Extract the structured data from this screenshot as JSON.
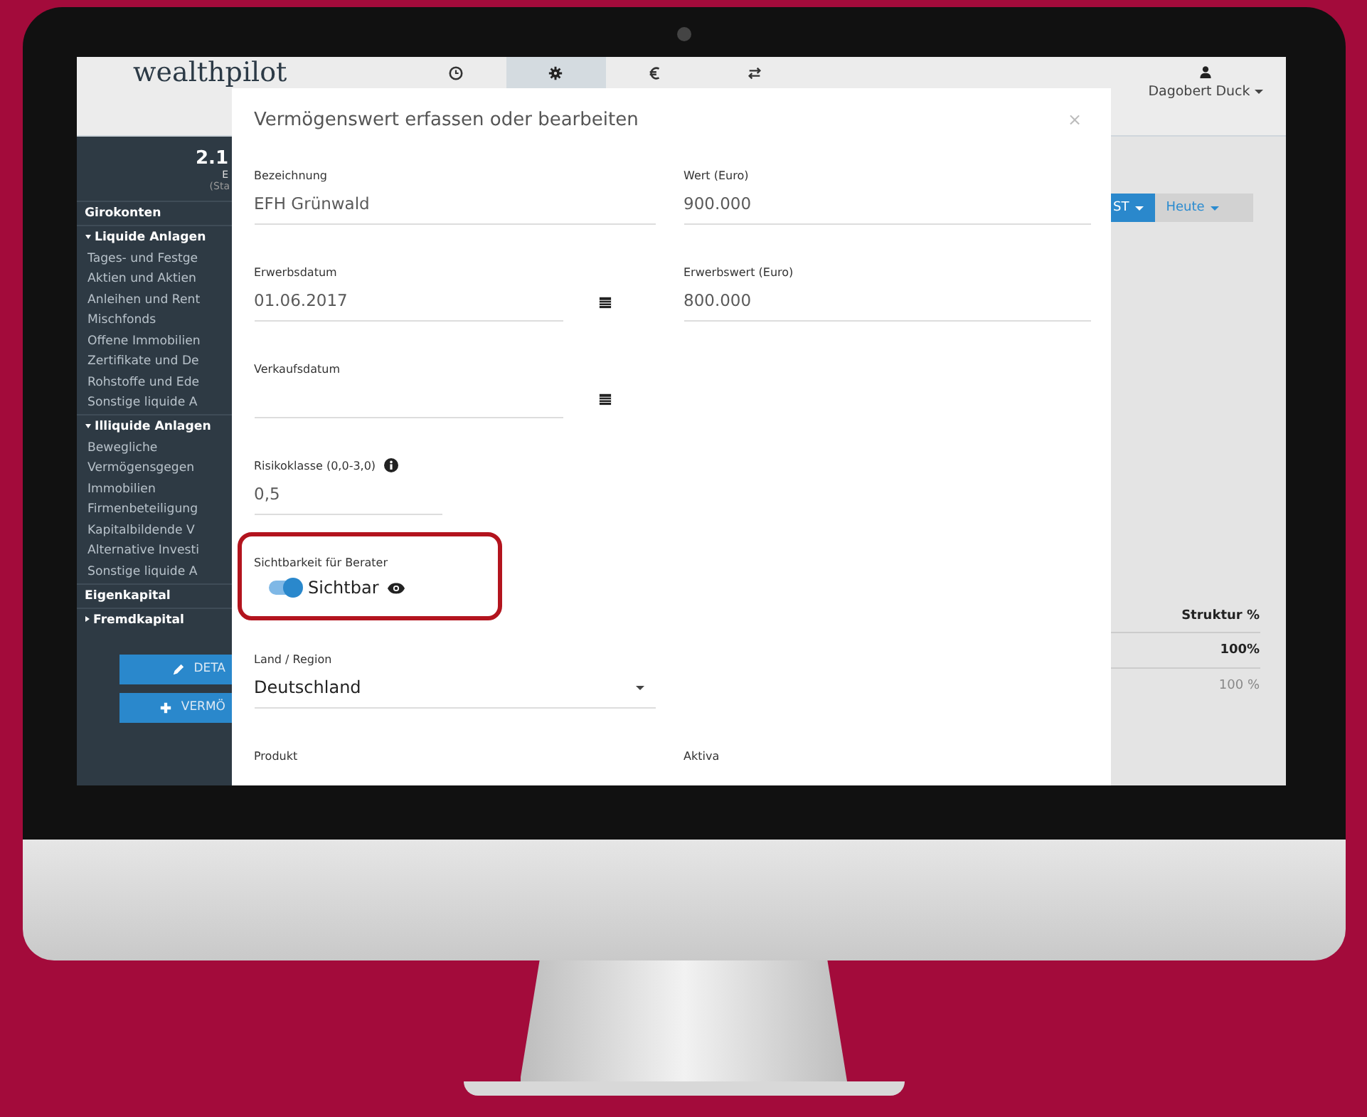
{
  "header": {
    "logo": "wealthpilot",
    "nav_tabs": [
      {
        "kind": "clock",
        "selected": false
      },
      {
        "kind": "gear",
        "selected": true
      },
      {
        "kind": "euro",
        "selected": false
      },
      {
        "kind": "swap",
        "selected": false
      }
    ],
    "user": {
      "name": "Dagobert Duck"
    }
  },
  "sidebar": {
    "total": "2.1",
    "total_sub": "E",
    "total_note": "(Sta",
    "groups": [
      {
        "label": "Girokonten",
        "kind": "plain"
      },
      {
        "label": "Liquide Anlagen",
        "kind": "group",
        "expanded": true,
        "children": [
          "Tages- und Festge",
          "Aktien und Aktien",
          "Anleihen und Rent",
          "Mischfonds",
          "Offene Immobilien",
          "Zertifikate und De",
          "Rohstoffe und Ede",
          "Sonstige liquide A"
        ]
      },
      {
        "label": "Illiquide Anlagen",
        "kind": "group",
        "expanded": true,
        "children": [
          "Bewegliche",
          "Vermögensgegen",
          "Immobilien",
          "Firmenbeteiligung",
          "Kapitalbildende V",
          "Alternative Investi",
          "Sonstige liquide A"
        ]
      },
      {
        "label": "Eigenkapital",
        "kind": "plain"
      },
      {
        "label": "Fremdkapital",
        "kind": "group",
        "expanded": false
      }
    ],
    "buttons": [
      {
        "label": "DETA",
        "kind": "edit"
      },
      {
        "label": "VERMÖ",
        "kind": "add"
      }
    ]
  },
  "breadcrumb": [
    {
      "label": "ST",
      "selected": true
    },
    {
      "label": "Heute",
      "selected": false
    }
  ],
  "table": {
    "header": "Struktur %",
    "total": "100%",
    "row": "100 %"
  },
  "modal": {
    "title": "Vermögenswert erfassen oder bearbeiten",
    "close": "×",
    "rows": [
      [
        {
          "kind": "text",
          "label": "Bezeichnung",
          "value": "EFH Grünwald"
        },
        {
          "kind": "text",
          "label": "Wert (Euro)",
          "value": "900.000"
        }
      ],
      [
        {
          "kind": "date",
          "label": "Erwerbsdatum",
          "value": "01.06.2017"
        },
        {
          "kind": "text",
          "label": "Erwerbswert (Euro)",
          "value": "800.000"
        }
      ],
      [
        {
          "kind": "date",
          "label": "Verkaufsdatum"
        }
      ],
      [
        {
          "kind": "info",
          "label": "Risikoklasse (0,0-3,0)",
          "value": "0,5"
        }
      ],
      [
        {
          "kind": "toggle",
          "label": "Sichtbarkeit für Berater",
          "value": "Sichtbar",
          "on": true,
          "highlighted": true
        }
      ],
      [
        {
          "kind": "select",
          "label": "Land / Region",
          "value": "Deutschland"
        }
      ],
      [
        {
          "kind": "label_only",
          "label": "Produkt"
        },
        {
          "kind": "label_only",
          "label": "Aktiva"
        }
      ]
    ]
  }
}
